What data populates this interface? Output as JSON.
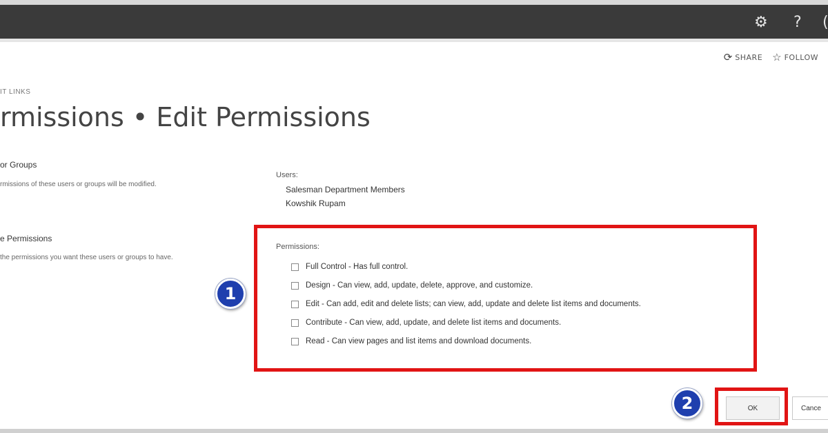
{
  "header": {
    "settings_icon": "⚙",
    "help_icon": "?",
    "account_icon": "(",
    "share_label": "SHARE",
    "share_icon": "⟳",
    "follow_label": "FOLLOW",
    "follow_icon": "☆"
  },
  "breadcrumb": "IT LINKS",
  "page_title": "rmissions • Edit Permissions",
  "users_or_groups": {
    "heading": "or Groups",
    "description": "rmissions of these users or groups will be modified."
  },
  "choose_permissions": {
    "heading": "e Permissions",
    "description": "the permissions you want these users or groups to have."
  },
  "users": {
    "label": "Users:",
    "list": [
      "Salesman Department Members",
      "Kowshik Rupam"
    ]
  },
  "permissions": {
    "label": "Permissions:",
    "options": [
      {
        "label": "Full Control - Has full control.",
        "checked": false
      },
      {
        "label": "Design - Can view, add, update, delete, approve, and customize.",
        "checked": false
      },
      {
        "label": "Edit - Can add, edit and delete lists; can view, add, update and delete list items and documents.",
        "checked": false
      },
      {
        "label": "Contribute - Can view, add, update, and delete list items and documents.",
        "checked": false
      },
      {
        "label": "Read - Can view pages and list items and download documents.",
        "checked": false
      }
    ]
  },
  "annotations": {
    "step1": "1",
    "step2": "2"
  },
  "buttons": {
    "ok": "OK",
    "cancel": "Cance"
  },
  "colors": {
    "highlight": "#e11414",
    "badge": "#1f3fae",
    "topbar": "#3a3a3a"
  }
}
